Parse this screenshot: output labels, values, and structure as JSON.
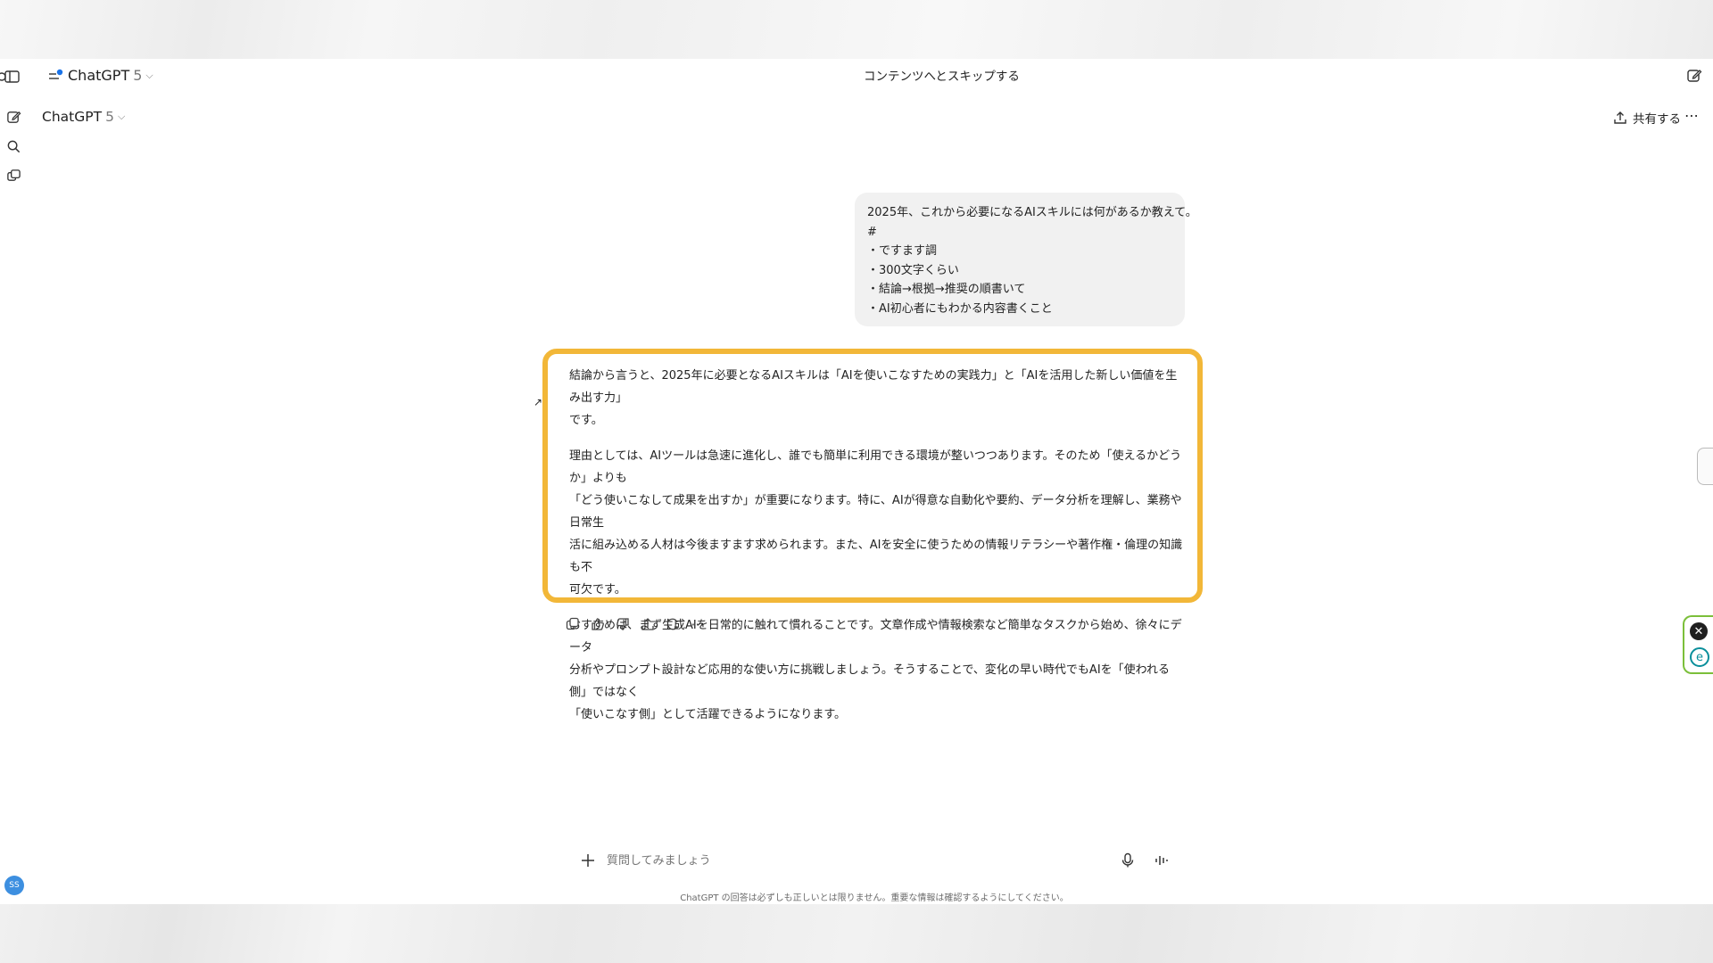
{
  "header": {
    "model_name": "ChatGPT",
    "model_version": "5",
    "skip_link": "コンテンツへとスキップする"
  },
  "subheader": {
    "model_name": "ChatGPT",
    "model_version": "5",
    "share_label": "共有する"
  },
  "user_message": {
    "lines": [
      "2025年、これから必要になるAIスキルには何があるか教えて。",
      "#",
      "・ですます調",
      "・300文字くらい",
      "・結論→根拠→推奨の順書いて",
      "・AI初心者にもわかる内容書くこと"
    ]
  },
  "assistant_message": {
    "paragraphs": [
      [
        "結論から言うと、2025年に必要となるAIスキルは「AIを使いこなすための実践力」と「AIを活用した新しい価値を生み出す力」",
        "です。"
      ],
      [
        "理由としては、AIツールは急速に進化し、誰でも簡単に利用できる環境が整いつつあります。そのため「使えるかどうか」よりも",
        "「どう使いこなして成果を出すか」が重要になります。特に、AIが得意な自動化や要約、データ分析を理解し、業務や日常生",
        "活に組み込める人材は今後ますます求められます。また、AIを安全に使うための情報リテラシーや著作権・倫理の知識も不",
        "可欠です。"
      ],
      [
        "おすすめは、まず生成AIを日常的に触れて慣れることです。文章作成や情報検索など簡単なタスクから始め、徐々にデータ",
        "分析やプロンプト設計など応用的な使い方に挑戦しましょう。そうすることで、変化の早い時代でもAIを「使われる側」ではなく",
        "「使いこなす側」として活躍できるようになります。"
      ]
    ]
  },
  "composer": {
    "placeholder": "質問してみましょう"
  },
  "footer": {
    "disclaimer": "ChatGPT の回答は必ずしも正しいとは限りません。重要な情報は確認するようにしてください。"
  },
  "user": {
    "initials": "SS"
  },
  "colors": {
    "highlight": "#f2b738",
    "avatar": "#3d8fe0",
    "header_dot": "#1a73e8"
  },
  "icons": [
    "sidebar-toggle-icon",
    "new-chat-icon",
    "search-icon",
    "library-icon",
    "copy-icon",
    "thumbs-up-icon",
    "thumbs-down-icon",
    "share-icon",
    "regenerate-icon",
    "more-icon",
    "plus-icon",
    "mic-icon",
    "voice-mode-icon",
    "edit-icon",
    "close-circle-icon",
    "extension-e-icon"
  ]
}
